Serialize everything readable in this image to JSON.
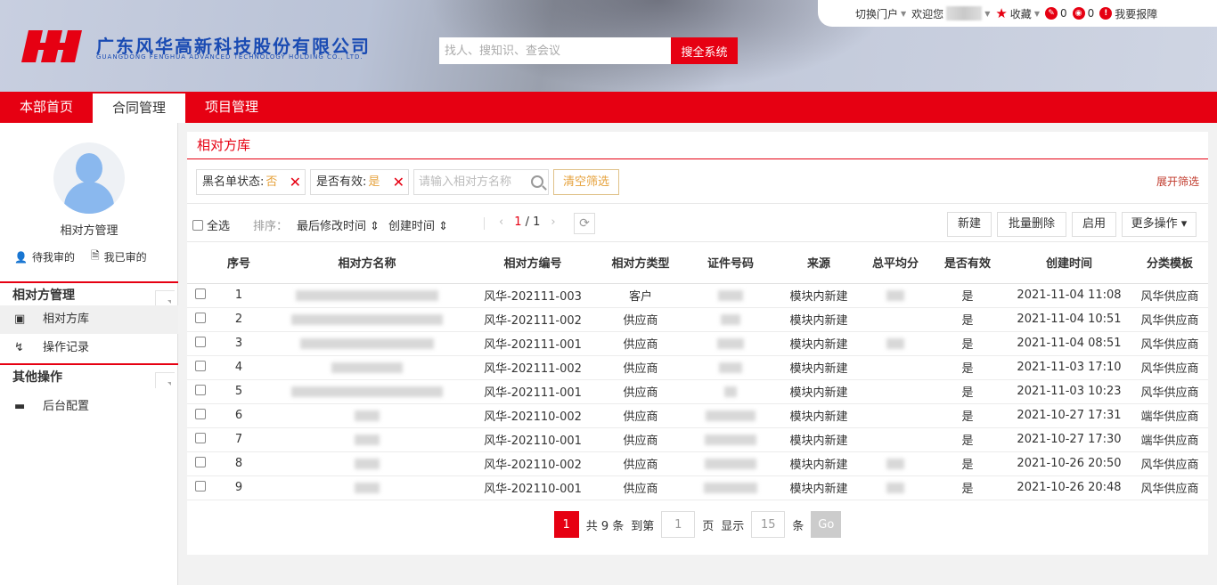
{
  "header": {
    "company_cn": "广东风华高新科技股份有限公司",
    "company_en": "GUANGDONG FENGHUA ADVANCED TECHNOLOGY HOLDING CO., LTD.",
    "search_placeholder": "找人、搜知识、查会议",
    "search_button": "搜全系统"
  },
  "topbar": {
    "switch_portal": "切换门户",
    "welcome": "欢迎您",
    "favorites": "收藏",
    "count_a": "0",
    "count_b": "0",
    "report": "我要报障"
  },
  "nav": {
    "tabs": [
      "本部首页",
      "合同管理",
      "项目管理"
    ],
    "active": 1
  },
  "sidebar": {
    "title": "相对方管理",
    "pending_label": "待我审的",
    "done_label": "我已审的",
    "section1": "相对方管理",
    "item_library": "相对方库",
    "item_records": "操作记录",
    "section2": "其他操作",
    "item_backend": "后台配置"
  },
  "panel": {
    "title": "相对方库",
    "filters": {
      "blacklist_label": "黑名单状态:",
      "blacklist_value": "否",
      "valid_label": "是否有效:",
      "valid_value": "是",
      "search_placeholder": "请输入相对方名称",
      "clear": "清空筛选",
      "expand": "展开筛选"
    },
    "toolbar": {
      "select_all": "全选",
      "sort_label": "排序：",
      "sort1": "最后修改时间 ⇕",
      "sort2": "创建时间 ⇕",
      "page_current": "1",
      "page_total": "1",
      "new": "新建",
      "batch_delete": "批量删除",
      "enable": "启用",
      "more": "更多操作 ▾"
    },
    "columns": [
      "序号",
      "相对方名称",
      "相对方编号",
      "相对方类型",
      "证件号码",
      "来源",
      "总平均分",
      "是否有效",
      "创建时间",
      "分类模板"
    ],
    "rows": [
      {
        "no": "1",
        "code": "风华-202111-003",
        "type": "客户",
        "source": "模块内新建",
        "valid": "是",
        "created": "2021-11-04 11:08",
        "template": "风华供应商"
      },
      {
        "no": "2",
        "code": "风华-202111-002",
        "type": "供应商",
        "source": "模块内新建",
        "valid": "是",
        "created": "2021-11-04 10:51",
        "template": "风华供应商"
      },
      {
        "no": "3",
        "code": "风华-202111-001",
        "type": "供应商",
        "source": "模块内新建",
        "valid": "是",
        "created": "2021-11-04 08:51",
        "template": "风华供应商"
      },
      {
        "no": "4",
        "code": "风华-202111-002",
        "type": "供应商",
        "source": "模块内新建",
        "valid": "是",
        "created": "2021-11-03 17:10",
        "template": "风华供应商"
      },
      {
        "no": "5",
        "code": "风华-202111-001",
        "type": "供应商",
        "source": "模块内新建",
        "valid": "是",
        "created": "2021-11-03 10:23",
        "template": "风华供应商"
      },
      {
        "no": "6",
        "code": "风华-202110-002",
        "type": "供应商",
        "source": "模块内新建",
        "valid": "是",
        "created": "2021-10-27 17:31",
        "template": "端华供应商"
      },
      {
        "no": "7",
        "code": "风华-202110-001",
        "type": "供应商",
        "source": "模块内新建",
        "valid": "是",
        "created": "2021-10-27 17:30",
        "template": "端华供应商"
      },
      {
        "no": "8",
        "code": "风华-202110-002",
        "type": "供应商",
        "source": "模块内新建",
        "valid": "是",
        "created": "2021-10-26 20:50",
        "template": "风华供应商"
      },
      {
        "no": "9",
        "code": "风华-202110-001",
        "type": "供应商",
        "source": "模块内新建",
        "valid": "是",
        "created": "2021-10-26 20:48",
        "template": "风华供应商"
      }
    ],
    "pagination": {
      "page": "1",
      "total_text": "共 9 条",
      "goto_label": "到第",
      "goto_value": "1",
      "page_unit": "页",
      "show_label": "显示",
      "page_size": "15",
      "size_unit": "条",
      "go": "Go"
    }
  },
  "colors": {
    "brand_red": "#e60012",
    "brand_blue": "#1a4bb3",
    "accent_orange": "#e6a23c"
  }
}
